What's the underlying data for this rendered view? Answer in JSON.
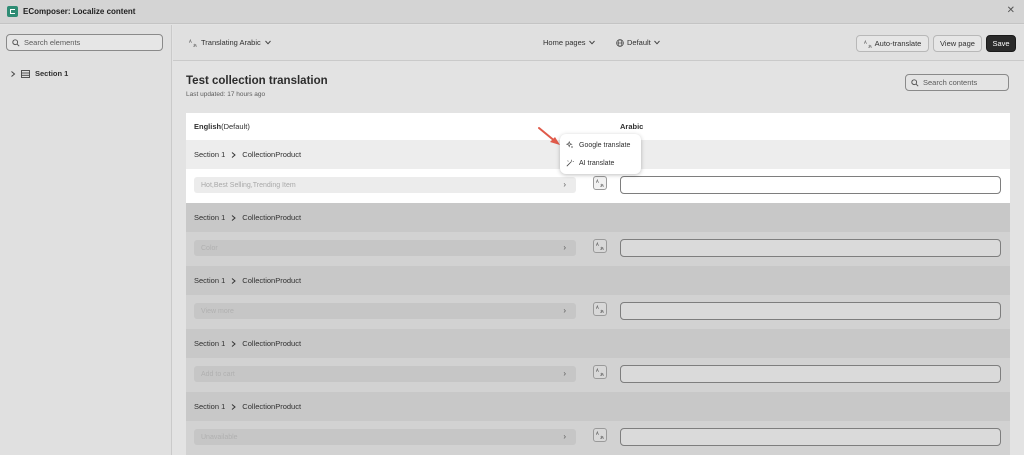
{
  "window": {
    "title": "EComposer: Localize content"
  },
  "sidebar": {
    "search_placeholder": "Search elements",
    "tree": [
      {
        "label": "Section 1"
      }
    ]
  },
  "toolbar": {
    "language_label": "Translating Arabic",
    "page_select": "Home pages",
    "locale_select": "Default",
    "auto_translate_label": "Auto-translate",
    "view_page_label": "View page",
    "save_label": "Save"
  },
  "main": {
    "title": "Test collection translation",
    "subtitle": "Last updated: 17 hours ago",
    "search_placeholder": "Search contents",
    "columns": {
      "english_bold": "English",
      "english_suffix": "(Default)",
      "arabic": "Arabic"
    },
    "groups": [
      {
        "section": "Section 1",
        "component": "CollectionProduct",
        "source": "Hot,Best Selling,Trending Item"
      },
      {
        "section": "Section 1",
        "component": "CollectionProduct",
        "source": "Color"
      },
      {
        "section": "Section 1",
        "component": "CollectionProduct",
        "source": "View more"
      },
      {
        "section": "Section 1",
        "component": "CollectionProduct",
        "source": "Add to cart"
      },
      {
        "section": "Section 1",
        "component": "CollectionProduct",
        "source": "Unavailable"
      }
    ]
  },
  "dropdown": {
    "items": [
      {
        "label": "Google translate"
      },
      {
        "label": "AI translate"
      }
    ]
  },
  "colors": {
    "save_bg": "#2a2a2a",
    "arrow": "#e05a4a",
    "logo": "#2e8c74"
  }
}
